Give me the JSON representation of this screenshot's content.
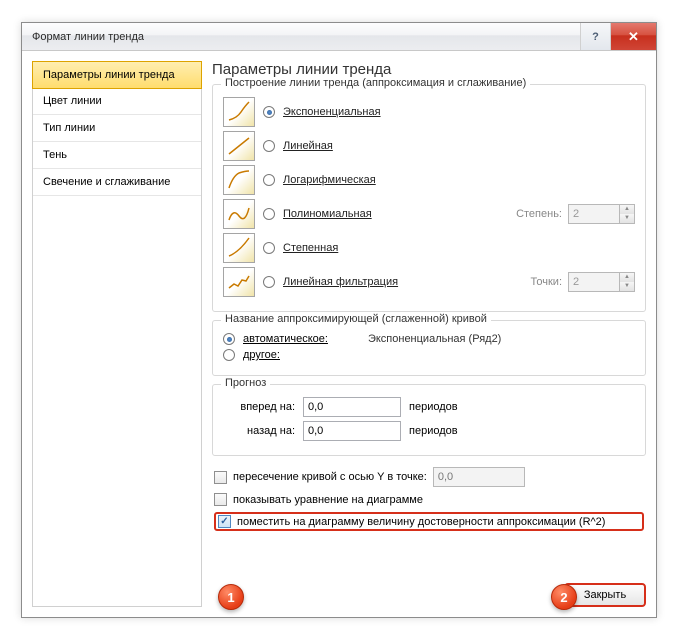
{
  "titlebar": {
    "title": "Формат линии тренда"
  },
  "sidebar": {
    "items": [
      {
        "label": "Параметры линии тренда",
        "active": true
      },
      {
        "label": "Цвет линии"
      },
      {
        "label": "Тип линии"
      },
      {
        "label": "Тень"
      },
      {
        "label": "Свечение и сглаживание"
      }
    ]
  },
  "main": {
    "heading": "Параметры линии тренда",
    "trend_group_title": "Построение линии тренда (аппроксимация и сглаживание)",
    "trend_types": {
      "exponential": "Экспоненциальная",
      "linear": "Линейная",
      "logarithmic": "Логарифмическая",
      "polynomial": "Полиномиальная",
      "power": "Степенная",
      "moving_avg": "Линейная фильтрация",
      "selected": "exponential",
      "degree_label": "Степень:",
      "degree_value": "2",
      "period_label": "Точки:",
      "period_value": "2"
    },
    "name_group": {
      "title": "Название аппроксимирующей (сглаженной) кривой",
      "auto_label": "автоматическое:",
      "auto_value": "Экспоненциальная (Ряд2)",
      "custom_label": "другое:",
      "selected": "auto"
    },
    "forecast": {
      "title": "Прогноз",
      "forward_label": "вперед на:",
      "forward_value": "0,0",
      "backward_label": "назад на:",
      "backward_value": "0,0",
      "unit": "периодов"
    },
    "checks": {
      "intercept_label": "пересечение кривой с осью Y в точке:",
      "intercept_value": "0,0",
      "intercept_checked": false,
      "show_eq_label": "показывать уравнение на диаграмме",
      "show_eq_checked": false,
      "show_r2_label": "поместить на диаграмму величину достоверности аппроксимации (R^2)",
      "show_r2_checked": true
    },
    "close_btn": "Закрыть"
  },
  "badges": {
    "one": "1",
    "two": "2"
  }
}
